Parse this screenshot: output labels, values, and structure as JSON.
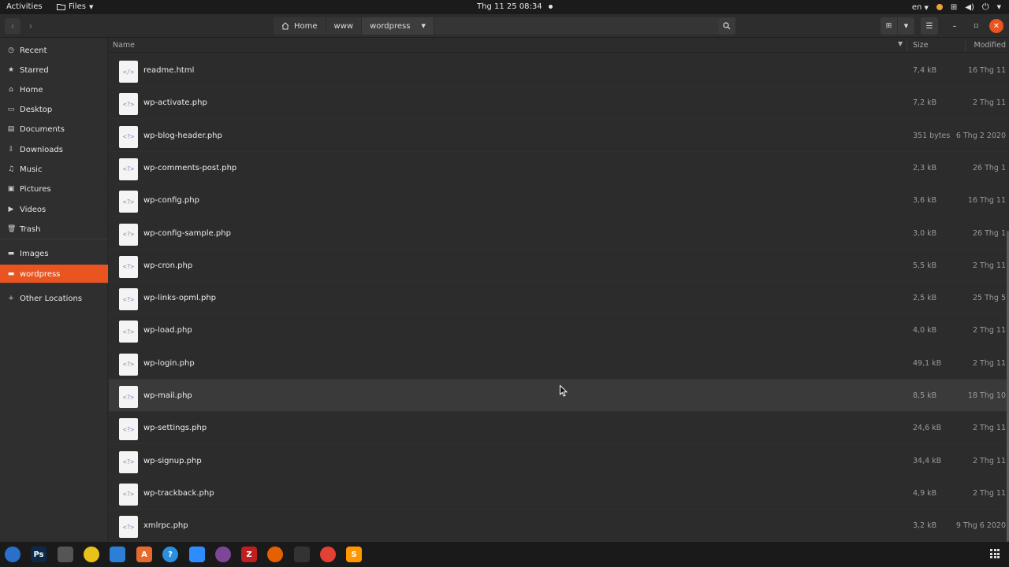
{
  "topbar": {
    "activities": "Activities",
    "app_name": "Files",
    "clock": "Thg 11 25  08:34",
    "lang": "en"
  },
  "pathbar": {
    "segments": [
      "Home",
      "www",
      "wordpress"
    ]
  },
  "sidebar": {
    "items": [
      {
        "label": "Recent",
        "icon": "clock-icon"
      },
      {
        "label": "Starred",
        "icon": "star-icon"
      },
      {
        "label": "Home",
        "icon": "home-icon"
      },
      {
        "label": "Desktop",
        "icon": "desktop-icon"
      },
      {
        "label": "Documents",
        "icon": "document-icon"
      },
      {
        "label": "Downloads",
        "icon": "download-icon"
      },
      {
        "label": "Music",
        "icon": "music-icon"
      },
      {
        "label": "Pictures",
        "icon": "picture-icon"
      },
      {
        "label": "Videos",
        "icon": "video-icon"
      },
      {
        "label": "Trash",
        "icon": "trash-icon"
      },
      {
        "label": "Images",
        "icon": "folder-icon"
      },
      {
        "label": "wordpress",
        "icon": "folder-icon",
        "active": true
      },
      {
        "label": "Other Locations",
        "icon": "plus-icon"
      }
    ]
  },
  "columns": {
    "name": "Name",
    "size": "Size",
    "modified": "Modified"
  },
  "files": [
    {
      "name": "readme.html",
      "size": "7,4 kB",
      "modified": "16 Thg 11",
      "icon": "html-file-icon",
      "glyph": "</>"
    },
    {
      "name": "wp-activate.php",
      "size": "7,2 kB",
      "modified": "2 Thg 11",
      "icon": "php-file-icon",
      "glyph": "<?>"
    },
    {
      "name": "wp-blog-header.php",
      "size": "351 bytes",
      "modified": "6 Thg 2 2020",
      "icon": "php-file-icon",
      "glyph": "<?>"
    },
    {
      "name": "wp-comments-post.php",
      "size": "2,3 kB",
      "modified": "26 Thg 1",
      "icon": "php-file-icon",
      "glyph": "<?>"
    },
    {
      "name": "wp-config.php",
      "size": "3,6 kB",
      "modified": "16 Thg 11",
      "icon": "php-file-icon",
      "glyph": "<?>"
    },
    {
      "name": "wp-config-sample.php",
      "size": "3,0 kB",
      "modified": "26 Thg 1",
      "icon": "php-file-icon",
      "glyph": "<?>"
    },
    {
      "name": "wp-cron.php",
      "size": "5,5 kB",
      "modified": "2 Thg 11",
      "icon": "php-file-icon",
      "glyph": "<?>"
    },
    {
      "name": "wp-links-opml.php",
      "size": "2,5 kB",
      "modified": "25 Thg 5",
      "icon": "php-file-icon",
      "glyph": "<?>"
    },
    {
      "name": "wp-load.php",
      "size": "4,0 kB",
      "modified": "2 Thg 11",
      "icon": "php-file-icon",
      "glyph": "<?>"
    },
    {
      "name": "wp-login.php",
      "size": "49,1 kB",
      "modified": "2 Thg 11",
      "icon": "php-file-icon",
      "glyph": "<?>"
    },
    {
      "name": "wp-mail.php",
      "size": "8,5 kB",
      "modified": "18 Thg 10",
      "icon": "php-file-icon",
      "glyph": "<?>",
      "hover": true
    },
    {
      "name": "wp-settings.php",
      "size": "24,6 kB",
      "modified": "2 Thg 11",
      "icon": "php-file-icon",
      "glyph": "<?>"
    },
    {
      "name": "wp-signup.php",
      "size": "34,4 kB",
      "modified": "2 Thg 11",
      "icon": "php-file-icon",
      "glyph": "<?>"
    },
    {
      "name": "wp-trackback.php",
      "size": "4,9 kB",
      "modified": "2 Thg 11",
      "icon": "php-file-icon",
      "glyph": "<?>"
    },
    {
      "name": "xmlrpc.php",
      "size": "3,2 kB",
      "modified": "9 Thg 6 2020",
      "icon": "php-file-icon",
      "glyph": "<?>"
    }
  ],
  "dock": {
    "apps": [
      {
        "name": "thunderbird-icon",
        "glyph": "",
        "color": "#2a6fc9"
      },
      {
        "name": "photoshop-icon",
        "glyph": "Ps",
        "color": "#0b2a4a"
      },
      {
        "name": "files-icon",
        "glyph": "",
        "color": "#6b6b6b",
        "active": true
      },
      {
        "name": "rhythmbox-icon",
        "glyph": "",
        "color": "#e8c11a"
      },
      {
        "name": "libreoffice-writer-icon",
        "glyph": "",
        "color": "#2c7fd6"
      },
      {
        "name": "software-center-icon",
        "glyph": "A",
        "color": "#e66a2c"
      },
      {
        "name": "help-icon",
        "glyph": "?",
        "color": "#2b8fe0"
      },
      {
        "name": "zoom-icon",
        "glyph": "",
        "color": "#2d8cff"
      },
      {
        "name": "tor-browser-icon",
        "glyph": "",
        "color": "#7d4698"
      },
      {
        "name": "filezilla-icon",
        "glyph": "Z",
        "color": "#bf1f1f"
      },
      {
        "name": "firefox-icon",
        "glyph": "",
        "color": "#e66000"
      },
      {
        "name": "terminal-icon",
        "glyph": "",
        "color": "#333333"
      },
      {
        "name": "chrome-icon",
        "glyph": "",
        "color": "#e44134"
      },
      {
        "name": "sublime-text-icon",
        "glyph": "S",
        "color": "#ff9800"
      }
    ]
  }
}
